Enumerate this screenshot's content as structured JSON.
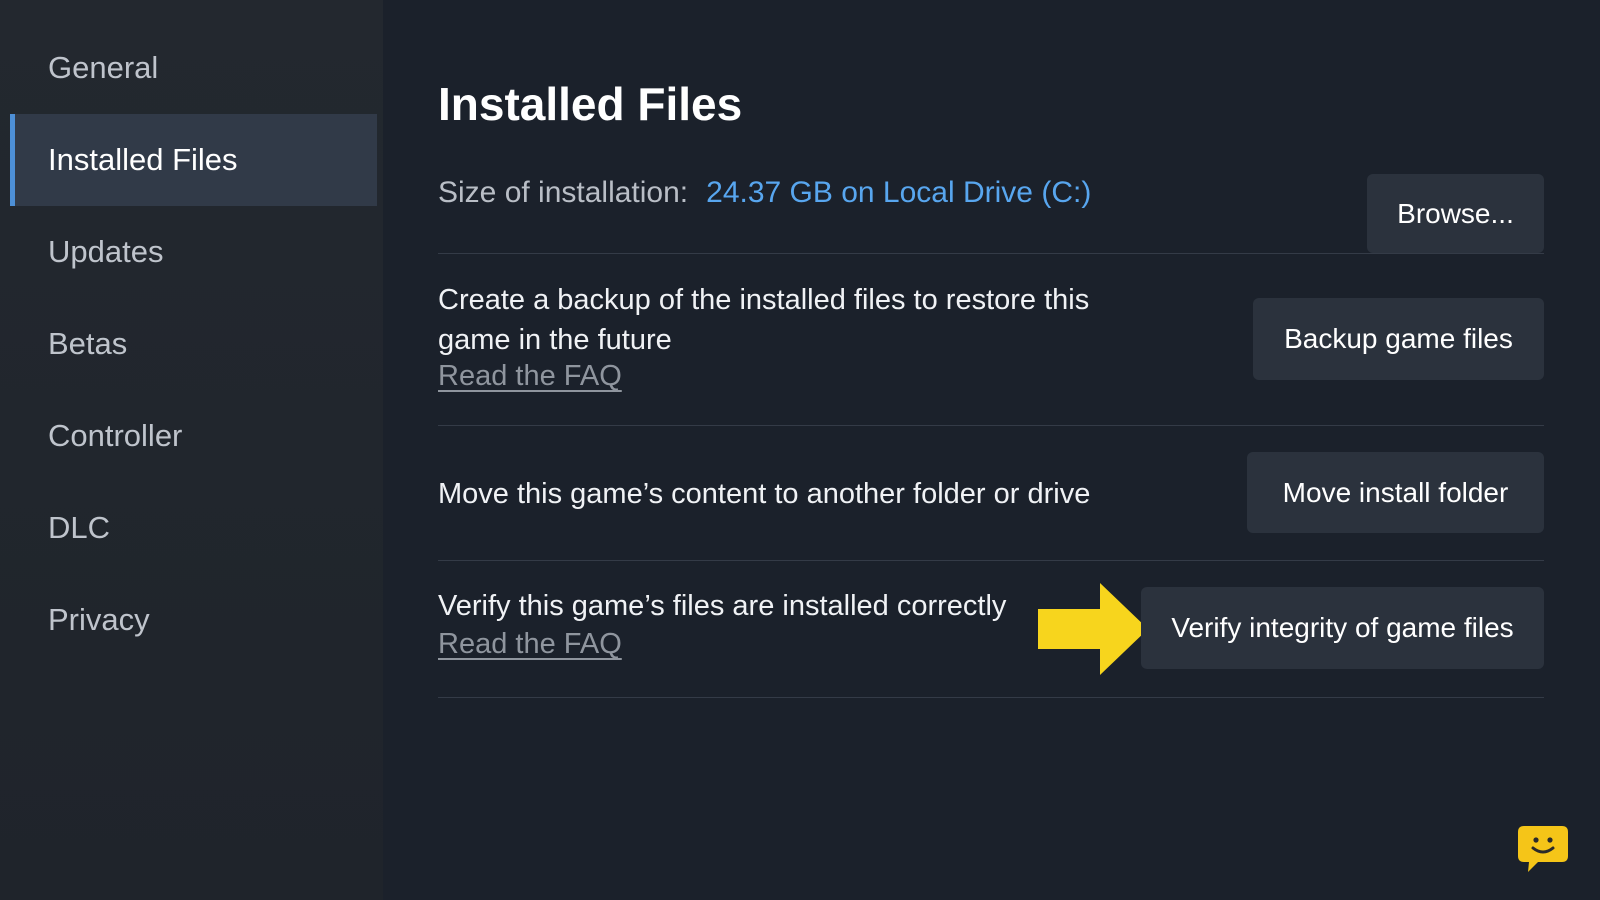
{
  "sidebar": {
    "items": [
      {
        "label": "General"
      },
      {
        "label": "Installed Files"
      },
      {
        "label": "Updates"
      },
      {
        "label": "Betas"
      },
      {
        "label": "Controller"
      },
      {
        "label": "DLC"
      },
      {
        "label": "Privacy"
      }
    ],
    "active": "Installed Files"
  },
  "main": {
    "title": "Installed Files",
    "size": {
      "label": "Size of installation:",
      "value": "24.37 GB on Local Drive (C:)",
      "browse_label": "Browse..."
    },
    "backup": {
      "description": "Create a backup of the installed files to restore this game in the future",
      "faq_label": "Read the FAQ",
      "button_label": "Backup game files"
    },
    "move": {
      "description": "Move this game’s content to another folder or drive",
      "button_label": "Move install folder"
    },
    "verify": {
      "description": "Verify this game’s files are installed correctly",
      "faq_label": "Read the FAQ",
      "button_label": "Verify integrity of game files"
    }
  },
  "colors": {
    "accent_blue": "#58a6ef",
    "arrow_yellow": "#f7d51d",
    "chat_yellow": "#f5c518"
  },
  "icons": {
    "arrow": "arrow-right-icon",
    "chat": "chat-smiley-icon"
  }
}
